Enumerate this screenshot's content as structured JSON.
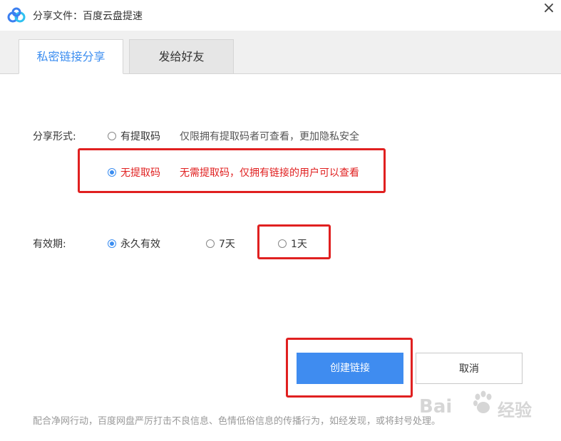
{
  "window": {
    "title": "分享文件：百度云盘提速",
    "close_glyph": "×"
  },
  "tabs": [
    {
      "label": "私密链接分享",
      "active": true
    },
    {
      "label": "发给好友",
      "active": false
    }
  ],
  "share_form": {
    "label": "分享形式:",
    "options": [
      {
        "label": "有提取码",
        "description": "仅限拥有提取码者可查看，更加隐私安全",
        "checked": false
      },
      {
        "label": "无提取码",
        "description": "无需提取码，仅拥有链接的用户可以查看",
        "checked": true
      }
    ]
  },
  "validity": {
    "label": "有效期:",
    "options": [
      {
        "label": "永久有效",
        "checked": true
      },
      {
        "label": "7天",
        "checked": false
      },
      {
        "label": "1天",
        "checked": false
      }
    ]
  },
  "buttons": {
    "create": "创建链接",
    "cancel": "取消"
  },
  "footer": {
    "note": "配合净网行动，百度网盘严厉打击不良信息、色情低俗信息的传播行为，如经发现，或将封号处理。"
  },
  "watermark": {
    "text_left": "Bai",
    "text_right": "经验"
  },
  "colors": {
    "accent": "#3b8df0",
    "highlight": "#e02020"
  }
}
